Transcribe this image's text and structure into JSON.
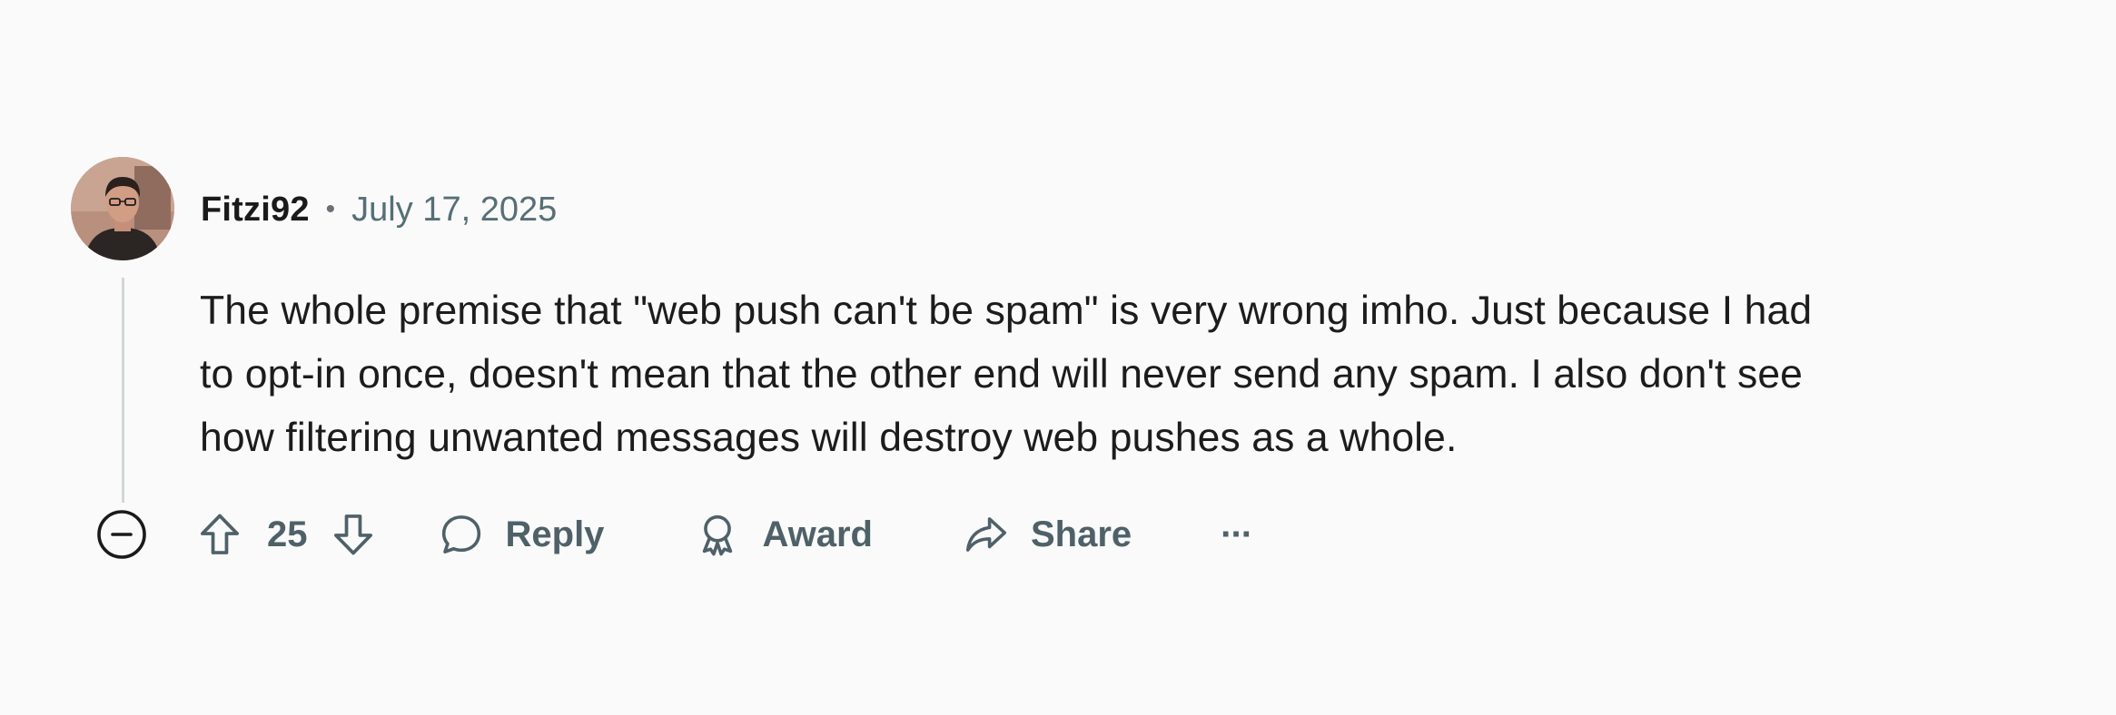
{
  "comment": {
    "author": "Fitzi92",
    "separator": "•",
    "date": "July 17, 2025",
    "body_lines": [
      "The whole premise that \"web push can't be spam\" is very wrong imho. Just because I had",
      "to opt-in once, doesn't mean that the other end will never send any spam. I also don't see",
      "how filtering unwanted messages will destroy web pushes as a whole."
    ]
  },
  "actions": {
    "score": "25",
    "reply_label": "Reply",
    "award_label": "Award",
    "share_label": "Share",
    "more_label": "···"
  },
  "icons": {
    "collapse": "minus-circle-icon",
    "upvote": "arrow-up-icon",
    "downvote": "arrow-down-icon",
    "reply": "speech-bubble-icon",
    "award": "award-ribbon-icon",
    "share": "share-arrow-icon",
    "more": "ellipsis-icon"
  },
  "colors": {
    "background": "#fafafa",
    "text": "#1c1c1c",
    "muted": "#576f76",
    "action": "#4f6168",
    "thread_line": "#d2d5d7"
  }
}
